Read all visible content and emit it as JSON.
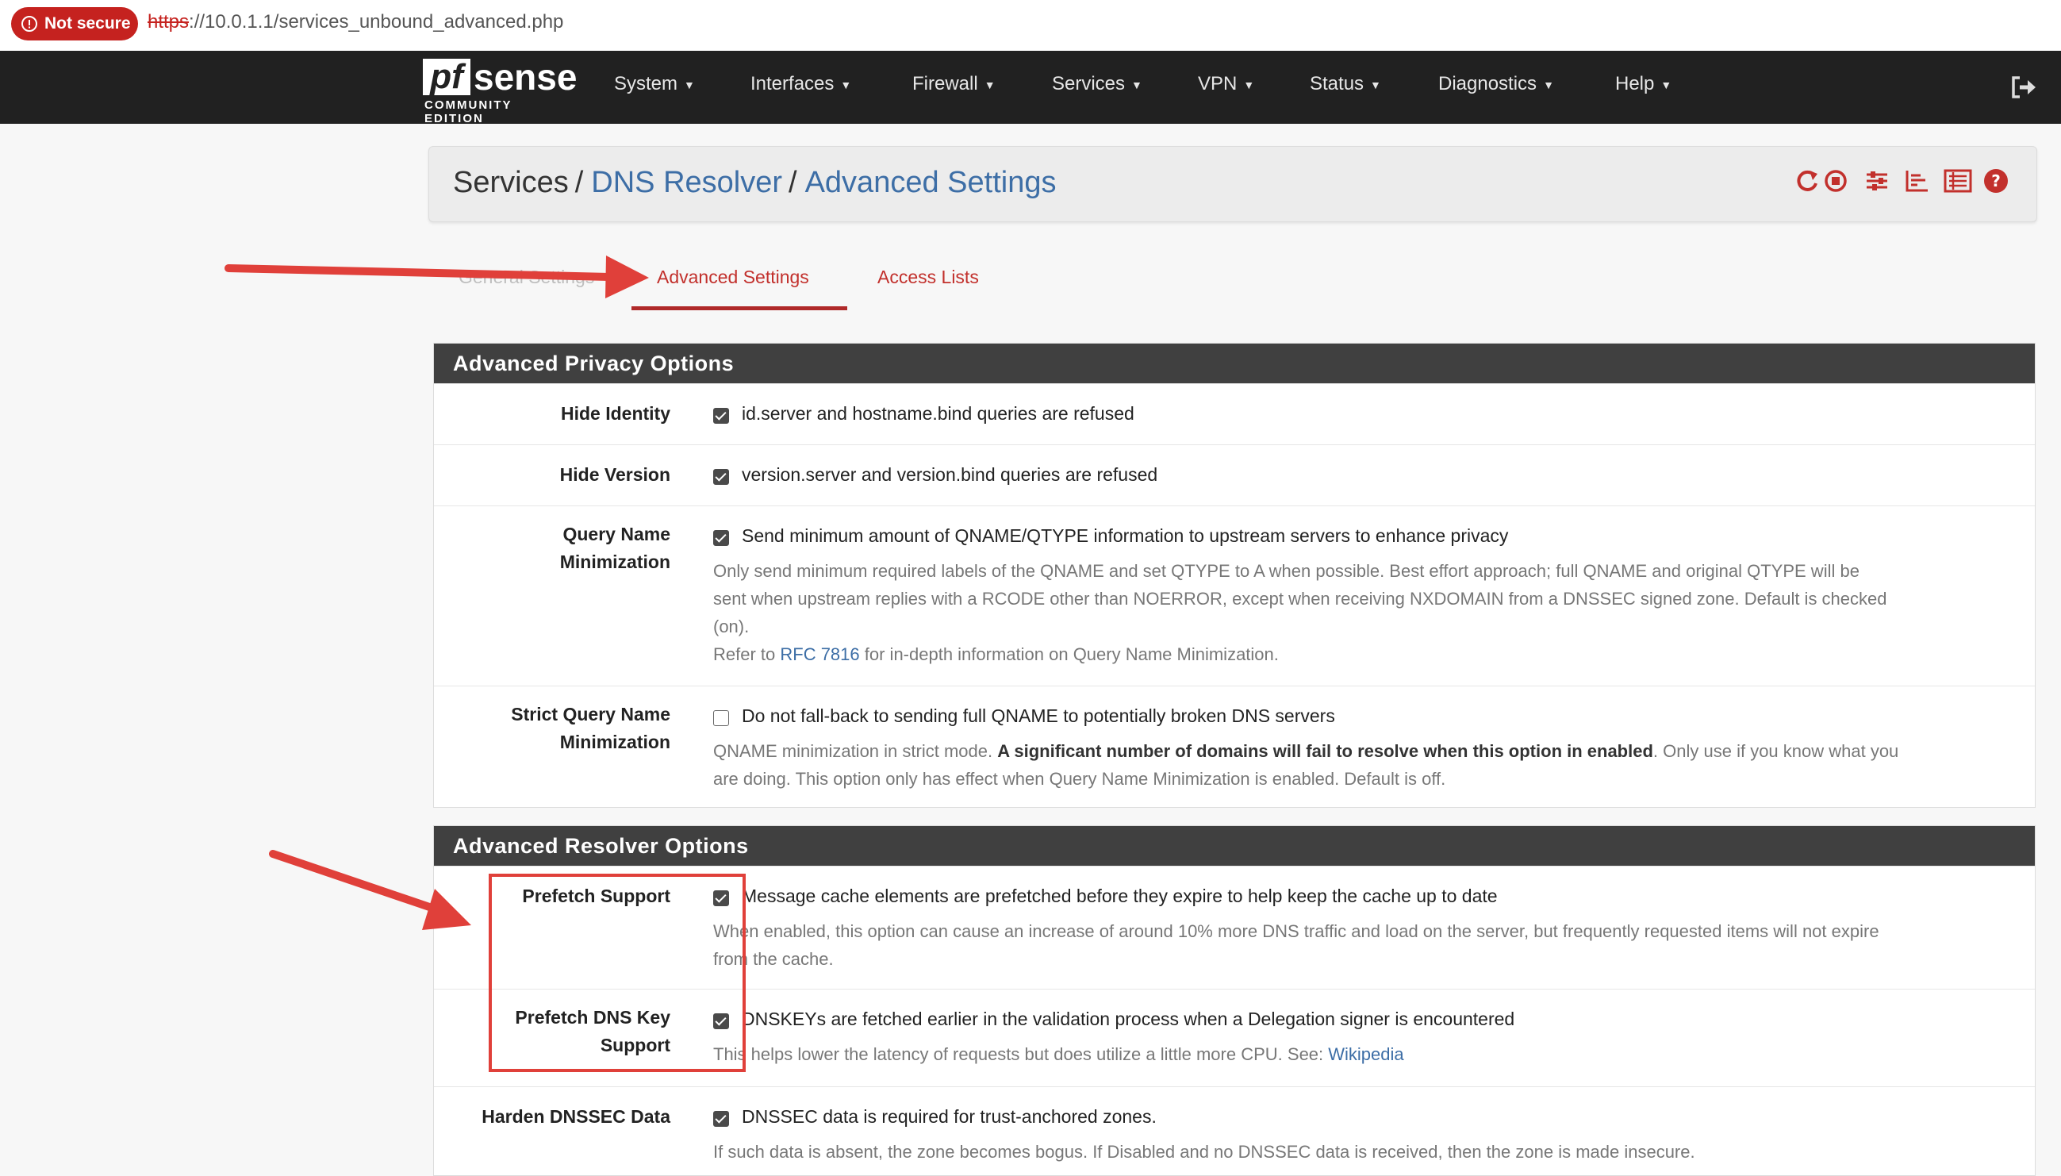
{
  "browser": {
    "security_label": "Not secure",
    "url_scheme": "https",
    "url_rest": "://10.0.1.1/services_unbound_advanced.php"
  },
  "nav": {
    "brand": "sense",
    "brand_prefix": "pf",
    "edition": "COMMUNITY EDITION",
    "menus": [
      "System",
      "Interfaces",
      "Firewall",
      "Services",
      "VPN",
      "Status",
      "Diagnostics",
      "Help"
    ]
  },
  "breadcrumb": {
    "items": [
      "Services",
      "DNS Resolver",
      "Advanced Settings"
    ],
    "separator": "/"
  },
  "header_icons": [
    "reload-icon",
    "stop-service-icon",
    "settings-sliders-icon",
    "chart-icon",
    "log-icon",
    "help-icon"
  ],
  "tabs": {
    "general": "General Settings",
    "advanced": "Advanced Settings",
    "access_lists": "Access Lists",
    "active": "Advanced Settings"
  },
  "privacy": {
    "title": "Advanced Privacy Options",
    "hide_identity": {
      "label": "Hide Identity",
      "checked": true,
      "text": "id.server and hostname.bind queries are refused"
    },
    "hide_version": {
      "label": "Hide Version",
      "checked": true,
      "text": "version.server and version.bind queries are refused"
    },
    "qname_min": {
      "label1": "Query Name",
      "label2": "Minimization",
      "checked": true,
      "text": "Send minimum amount of QNAME/QTYPE information to upstream servers to enhance privacy",
      "help1": "Only send minimum required labels of the QNAME and set QTYPE to A when possible. Best effort approach; full QNAME and original QTYPE will be",
      "help2": "sent when upstream replies with a RCODE other than NOERROR, except when receiving NXDOMAIN from a DNSSEC signed zone. Default is checked",
      "help3": "(on).",
      "help4_pre": "Refer to ",
      "help4_link": "RFC 7816",
      "help4_post": " for in-depth information on Query Name Minimization."
    },
    "strict_qname": {
      "label1": "Strict Query Name",
      "label2": "Minimization",
      "checked": false,
      "text": "Do not fall-back to sending full QNAME to potentially broken DNS servers",
      "help1_pre": "QNAME minimization in strict mode. ",
      "help1_bold": "A significant number of domains will fail to resolve when this option in enabled",
      "help1_post": ". Only use if you know what you",
      "help2": "are doing. This option only has effect when Query Name Minimization is enabled. Default is off."
    }
  },
  "resolver": {
    "title": "Advanced Resolver Options",
    "prefetch": {
      "label": "Prefetch Support",
      "checked": true,
      "text": "Message cache elements are prefetched before they expire to help keep the cache up to date",
      "help1": "When enabled, this option can cause an increase of around 10% more DNS traffic and load on the server, but frequently requested items will not expire",
      "help2": "from the cache."
    },
    "prefetch_key": {
      "label1": "Prefetch DNS Key",
      "label2": "Support",
      "checked": true,
      "text": "DNSKEYs are fetched earlier in the validation process when a Delegation signer is encountered",
      "help_pre": "This helps lower the latency of requests but does utilize a little more CPU. See: ",
      "help_link": "Wikipedia"
    },
    "harden_dnssec": {
      "label": "Harden DNSSEC Data",
      "checked": true,
      "text": "DNSSEC data is required for trust-anchored zones.",
      "help": "If such data is absent, the zone becomes bogus. If Disabled and no DNSSEC data is received, then the zone is made insecure."
    }
  },
  "colors": {
    "navbar": "#212121",
    "accent_red": "#c2302c",
    "link_blue": "#3d6ea6",
    "panel_head": "#404040",
    "annotation_red": "#e0403a"
  }
}
